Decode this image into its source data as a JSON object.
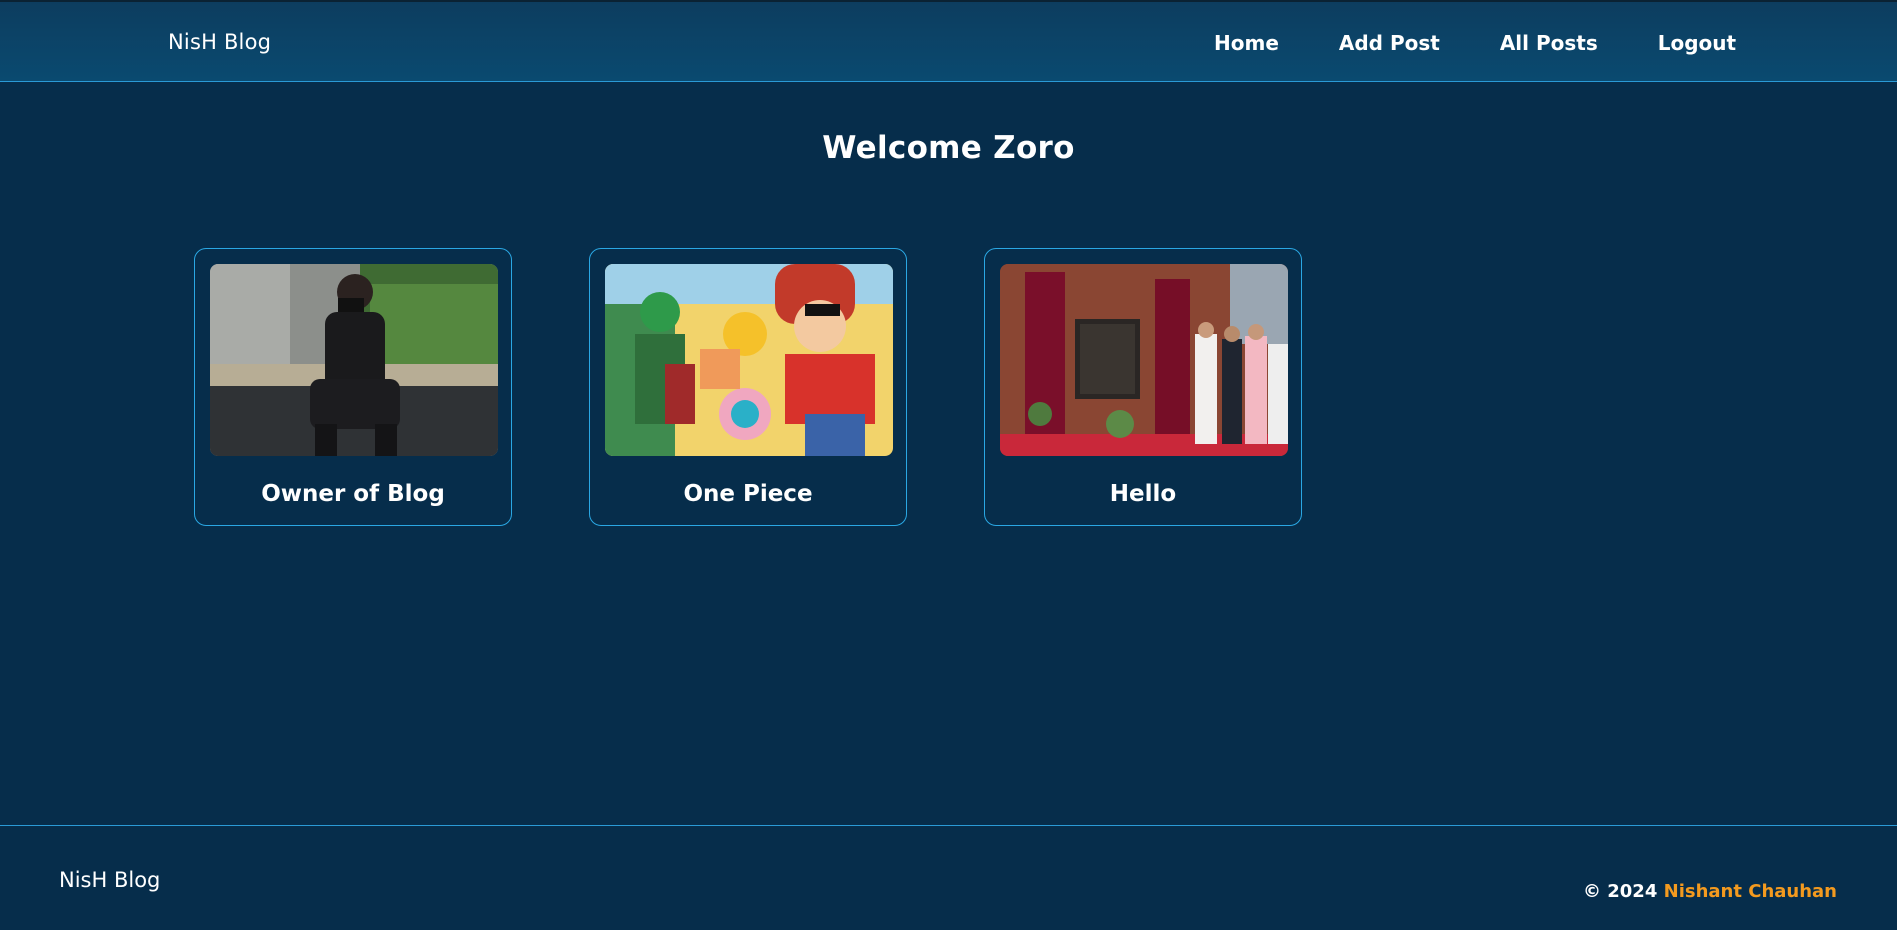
{
  "header": {
    "brand": "NisH Blog",
    "nav": [
      "Home",
      "Add Post",
      "All Posts",
      "Logout"
    ]
  },
  "main": {
    "welcome": "Welcome Zoro",
    "posts": [
      {
        "title": "Owner of Blog",
        "image": "person-sitting-photo"
      },
      {
        "title": "One Piece",
        "image": "anime-crew-illustration"
      },
      {
        "title": "Hello",
        "image": "inauguration-ceremony-photo"
      }
    ]
  },
  "footer": {
    "brand": "NisH Blog",
    "copyright": "© 2024",
    "author": "Nishant Chauhan"
  },
  "colors": {
    "background": "#062d4b",
    "header": "#0a4a70",
    "card_border": "#2aa7e3",
    "accent": "#f39a1f"
  }
}
